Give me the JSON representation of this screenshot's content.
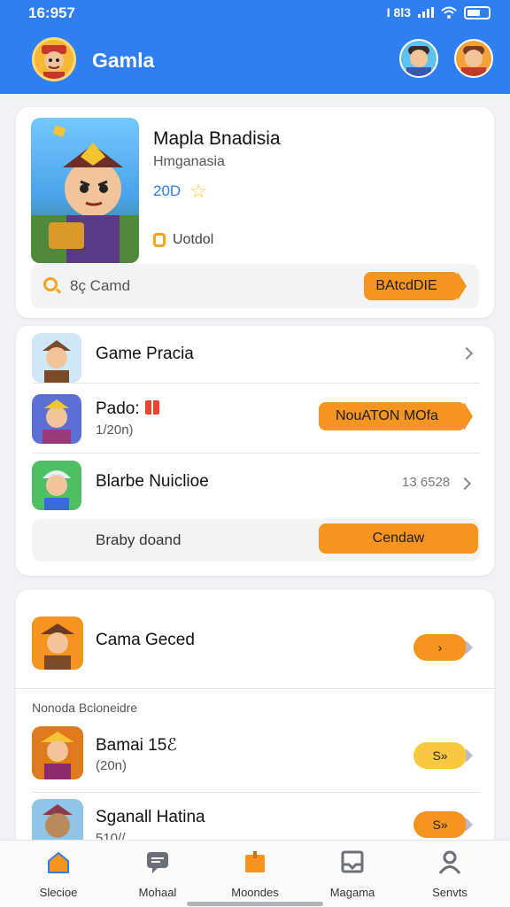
{
  "status": {
    "time": "16:957",
    "network": "I 8l3"
  },
  "header": {
    "title": "Gamla",
    "logo_icon": "game-character-logo",
    "avatars": [
      "male-avatar-blue",
      "male-avatar-orange"
    ]
  },
  "featured": {
    "title": "Mapla Bnadisia",
    "subtitle": "Hmganasia",
    "rating": "20D",
    "meta": "Uotdol",
    "search_label": "8ç Camd",
    "action_label": "BAtcdDIE"
  },
  "list": [
    {
      "label": "Game Pracia",
      "sub": "",
      "action": ""
    },
    {
      "label": "Pado:",
      "sub": "1/20n)",
      "action": "NouATON MOfa"
    },
    {
      "label": "Blarbe Nuiclioe",
      "sub": "",
      "value": "13 6528"
    }
  ],
  "list_footer": {
    "label": "Braby doand",
    "action": "Cendaw"
  },
  "section": {
    "top_item": {
      "label": "Cama Geced"
    },
    "label": "Nonoda Bcloneidre",
    "items": [
      {
        "label": "Bamai 15ℰ",
        "sub": "(20n)",
        "action": "S»"
      },
      {
        "label": "Sganall Hatina",
        "sub": "510//",
        "action": "S»"
      }
    ]
  },
  "nav": [
    {
      "label": "Slecioe",
      "icon": "home-icon"
    },
    {
      "label": "Mohaal",
      "icon": "chat-icon"
    },
    {
      "label": "Moondes",
      "icon": "box-icon"
    },
    {
      "label": "Magama",
      "icon": "tray-icon"
    },
    {
      "label": "Senvts",
      "icon": "user-icon"
    }
  ],
  "colors": {
    "primary": "#2f7ff0",
    "accent": "#f5941f",
    "yellow": "#f9c83f"
  }
}
